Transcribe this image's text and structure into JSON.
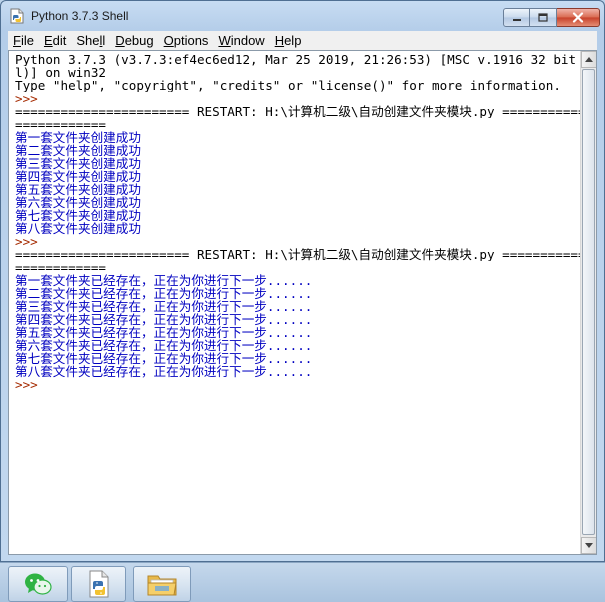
{
  "window": {
    "title": "Python 3.7.3 Shell"
  },
  "menu": [
    {
      "pre": "",
      "u": "F",
      "post": "ile"
    },
    {
      "pre": "",
      "u": "E",
      "post": "dit"
    },
    {
      "pre": "She",
      "u": "l",
      "post": "l"
    },
    {
      "pre": "",
      "u": "D",
      "post": "ebug"
    },
    {
      "pre": "",
      "u": "O",
      "post": "ptions"
    },
    {
      "pre": "",
      "u": "W",
      "post": "indow"
    },
    {
      "pre": "",
      "u": "H",
      "post": "elp"
    }
  ],
  "shell": {
    "lines": [
      {
        "text": "Python 3.7.3 (v3.7.3:ef4ec6ed12, Mar 25 2019, 21:26:53) [MSC v.1916 32 bit (Inte",
        "style": "black"
      },
      {
        "text": "l)] on win32",
        "style": "black"
      },
      {
        "text": "Type \"help\", \"copyright\", \"credits\" or \"license()\" for more information.",
        "style": "black"
      },
      {
        "text": ">>> ",
        "style": "brown"
      },
      {
        "text": "======================= RESTART: H:\\计算机二级\\自动创建文件夹模块.py ===========",
        "style": "black"
      },
      {
        "text": "============",
        "style": "black"
      },
      {
        "text": "第一套文件夹创建成功",
        "style": "blue"
      },
      {
        "text": "第二套文件夹创建成功",
        "style": "blue"
      },
      {
        "text": "第三套文件夹创建成功",
        "style": "blue"
      },
      {
        "text": "第四套文件夹创建成功",
        "style": "blue"
      },
      {
        "text": "第五套文件夹创建成功",
        "style": "blue"
      },
      {
        "text": "第六套文件夹创建成功",
        "style": "blue"
      },
      {
        "text": "第七套文件夹创建成功",
        "style": "blue"
      },
      {
        "text": "第八套文件夹创建成功",
        "style": "blue"
      },
      {
        "text": ">>> ",
        "style": "brown"
      },
      {
        "text": "======================= RESTART: H:\\计算机二级\\自动创建文件夹模块.py ===========",
        "style": "black"
      },
      {
        "text": "============",
        "style": "black"
      },
      {
        "text": "第一套文件夹已经存在，正在为你进行下一步......",
        "style": "blue"
      },
      {
        "text": "第二套文件夹已经存在，正在为你进行下一步......",
        "style": "blue"
      },
      {
        "text": "第三套文件夹已经存在，正在为你进行下一步......",
        "style": "blue"
      },
      {
        "text": "第四套文件夹已经存在，正在为你进行下一步......",
        "style": "blue"
      },
      {
        "text": "第五套文件夹已经存在，正在为你进行下一步......",
        "style": "blue"
      },
      {
        "text": "第六套文件夹已经存在，正在为你进行下一步......",
        "style": "blue"
      },
      {
        "text": "第七套文件夹已经存在，正在为你进行下一步......",
        "style": "blue"
      },
      {
        "text": "第八套文件夹已经存在，正在为你进行下一步......",
        "style": "blue"
      },
      {
        "text": ">>> ",
        "style": "brown"
      }
    ]
  },
  "taskbar": {
    "items": [
      "wechat-icon",
      "python-idle-icon",
      "file-explorer-icon"
    ]
  }
}
